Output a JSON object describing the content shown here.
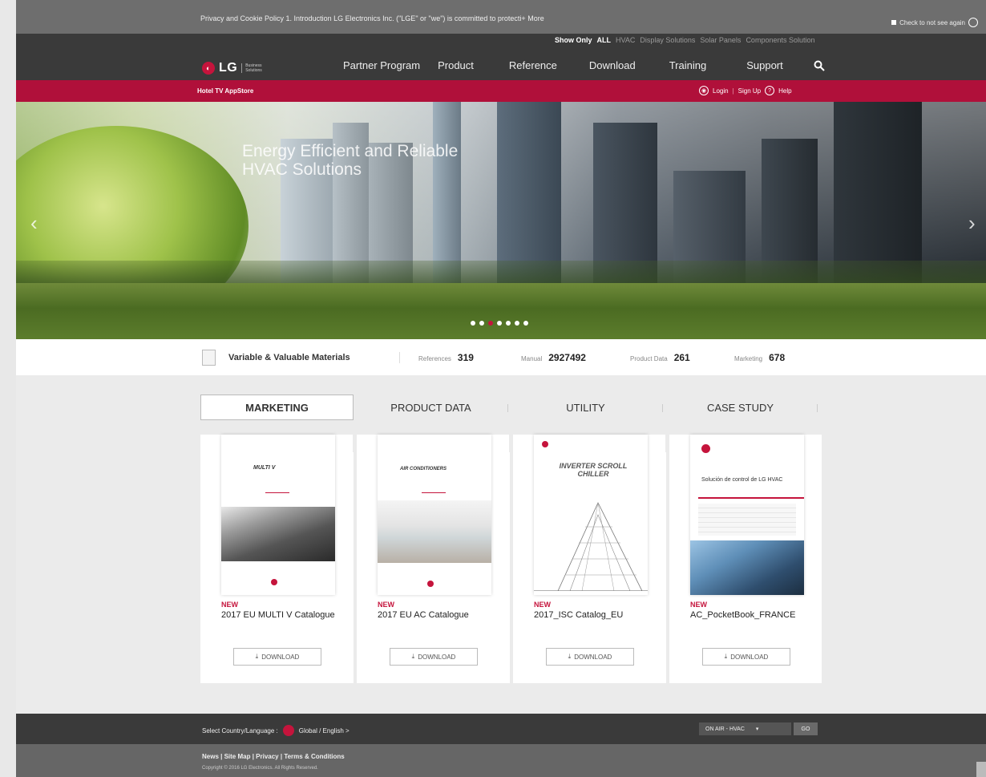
{
  "cookie_bar": {
    "text": "Privacy and Cookie Policy 1. Introduction LG Electronics Inc. (\"LGE\" or \"we\") is committed to protecti+ More",
    "checkbox_label": "Check to not see again"
  },
  "show_only": {
    "label": "Show Only",
    "options": [
      "ALL",
      "HVAC",
      "Display Solutions",
      "Solar Panels",
      "Components Solution"
    ],
    "active": "ALL"
  },
  "logo": {
    "brand": "LG",
    "sub1": "Business",
    "sub2": "Solutions"
  },
  "nav": [
    "Partner Program",
    "Product",
    "Reference",
    "Download",
    "Training",
    "Support"
  ],
  "subbar": {
    "appstore": "Hotel TV AppStore",
    "login": "Login",
    "signup": "Sign Up",
    "help": "Help"
  },
  "hero": {
    "title": "Energy Efficient and Reliable HVAC Solutions",
    "slide_count": 7,
    "active_slide": 3
  },
  "stats": {
    "title": "Variable & Valuable Materials",
    "items": [
      {
        "label": "References",
        "value": "319"
      },
      {
        "label": "Manual",
        "value": "2927492"
      },
      {
        "label": "Product Data",
        "value": "261"
      },
      {
        "label": "Marketing",
        "value": "678"
      }
    ]
  },
  "tabs": [
    "MARKETING",
    "PRODUCT DATA",
    "UTILITY",
    "CASE STUDY"
  ],
  "active_tab": "MARKETING",
  "cards": [
    {
      "badge": "NEW",
      "name": "2017 EU MULTI V Catalogue",
      "cover_title": "MULTI V",
      "download": "DOWNLOAD"
    },
    {
      "badge": "NEW",
      "name": "2017 EU AC Catalogue",
      "cover_title": "AIR CONDITIONERS",
      "download": "DOWNLOAD"
    },
    {
      "badge": "NEW",
      "name": "2017_ISC Catalog_EU",
      "cover_title": "INVERTER SCROLL CHILLER",
      "download": "DOWNLOAD"
    },
    {
      "badge": "NEW",
      "name": "AC_PocketBook_FRANCE",
      "cover_title": "Solución de control de LG HVAC",
      "download": "DOWNLOAD"
    }
  ],
  "footer": {
    "select_label": "Select Country/Language :",
    "language": "Global / English >",
    "on_air": "ON AIR - HVAC",
    "go": "GO",
    "links": "News | Site Map | Privacy | Terms & Conditions",
    "copyright": "Copyright © 2016 LG Electronics. All Rights Reserved."
  },
  "colors": {
    "brand_red": "#c5143c",
    "subbar_red": "#b0103a",
    "header_dark": "#3a3a3a"
  }
}
